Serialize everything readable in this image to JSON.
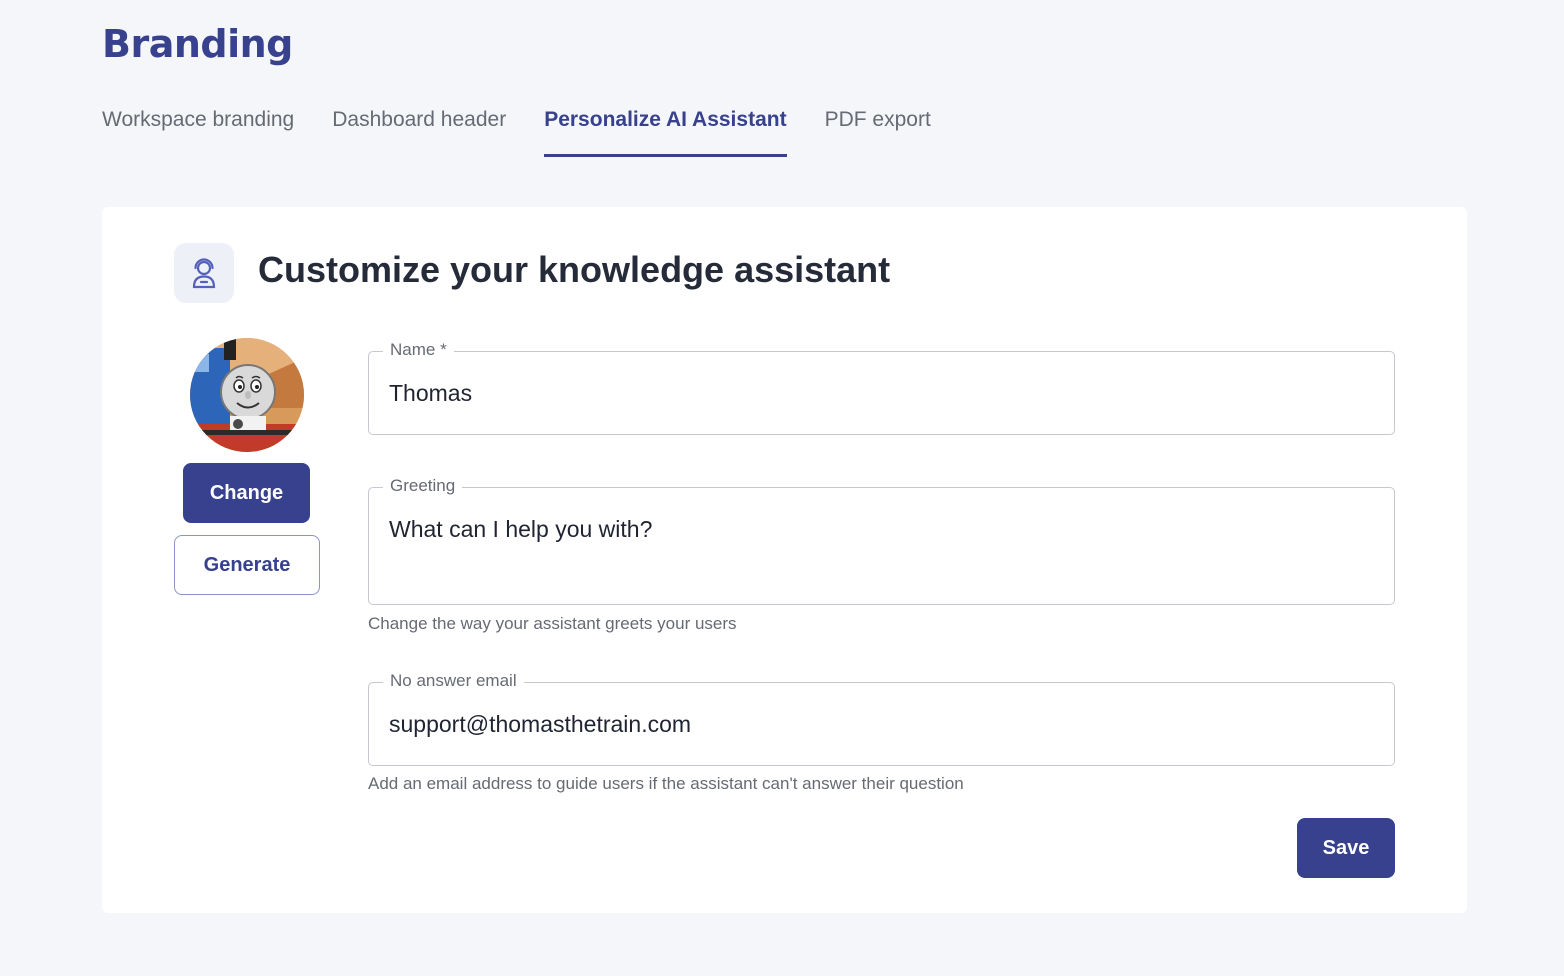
{
  "app": {
    "title": "Branding"
  },
  "tabs": [
    {
      "label": "Workspace branding",
      "active": false
    },
    {
      "label": "Dashboard header",
      "active": false
    },
    {
      "label": "Personalize AI Assistant",
      "active": true
    },
    {
      "label": "PDF export",
      "active": false
    }
  ],
  "card": {
    "icon": "assistant-icon",
    "title": "Customize your knowledge assistant"
  },
  "avatar": {
    "icon": "train-avatar"
  },
  "buttons": {
    "change": "Change",
    "generate": "Generate",
    "save": "Save"
  },
  "fields": {
    "name": {
      "label": "Name *",
      "value": "Thomas"
    },
    "greeting": {
      "label": "Greeting",
      "value": "What can I help you with?",
      "helper": "Change the way your assistant greets your users"
    },
    "email": {
      "label": "No answer email",
      "value": "support@thomasthetrain.com",
      "helper": "Add an email address to guide users if the assistant can't answer their question"
    }
  },
  "colors": {
    "accent": "#37418d",
    "background": "#f5f6fa",
    "card": "#ffffff",
    "muted_text": "#666a73"
  }
}
